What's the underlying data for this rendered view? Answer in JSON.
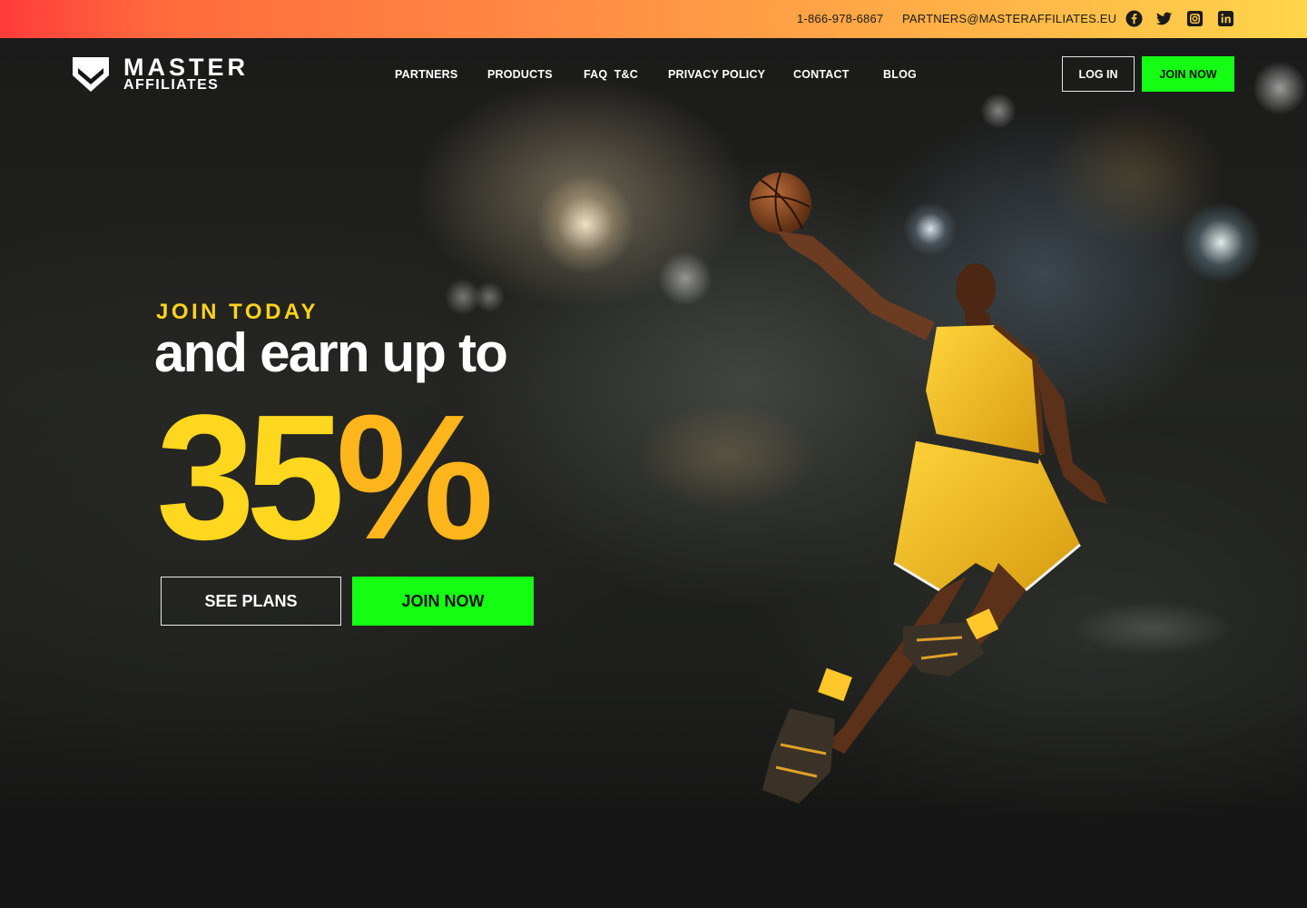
{
  "topbar": {
    "phone": "1-866-978-6867",
    "email": "PARTNERS@MASTERAFFILIATES.EU",
    "social": [
      "facebook-icon",
      "twitter-icon",
      "instagram-icon",
      "linkedin-icon"
    ]
  },
  "brand": {
    "line1": "MASTER",
    "line2": "AFFILIATES"
  },
  "nav": {
    "items": [
      {
        "label": "PARTNERS"
      },
      {
        "label": "PRODUCTS"
      },
      {
        "label": "FAQ  T&C"
      },
      {
        "label": "PRIVACY POLICY"
      },
      {
        "label": "CONTACT"
      },
      {
        "label": "BLOG"
      }
    ]
  },
  "header": {
    "login_label": "LOG IN",
    "join_label": "JOIN NOW"
  },
  "hero": {
    "eyebrow": "JOIN TODAY",
    "headline": "and earn up to",
    "number": "35",
    "percent": "%",
    "see_plans_label": "SEE PLANS",
    "join_label": "JOIN NOW"
  },
  "colors": {
    "accent_green": "#14ff14",
    "accent_yellow": "#ffd71f",
    "accent_orange": "#ffb51b",
    "gradient_start": "#ff3b3b",
    "gradient_end": "#ffd54a"
  }
}
